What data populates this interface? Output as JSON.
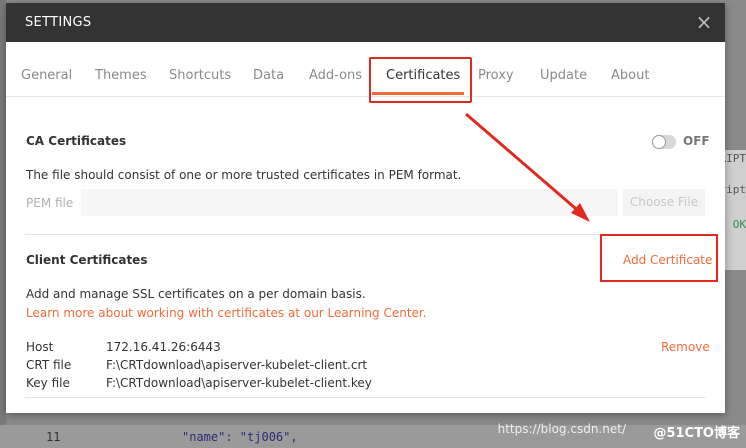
{
  "background": {
    "right_snippets": [
      "RIPT",
      "ript",
      "OK"
    ],
    "line_number": "11",
    "code_line": "\"name\": \"tj006\",",
    "watermark": "https://blog.csdn.net/",
    "logo": "@51CTO博客"
  },
  "modal": {
    "title": "SETTINGS",
    "close_icon": "×"
  },
  "tabs": [
    "General",
    "Themes",
    "Shortcuts",
    "Data",
    "Add-ons",
    "Certificates",
    "Proxy",
    "Update",
    "About"
  ],
  "active_tab": "Certificates",
  "ca": {
    "title": "CA Certificates",
    "toggle_label": "OFF",
    "description": "The file should consist of one or more trusted certificates in PEM format.",
    "pem_label": "PEM file",
    "choose_file": "Choose File"
  },
  "client": {
    "title": "Client Certificates",
    "add_button": "Add Certificate",
    "description": "Add and manage SSL certificates on a per domain basis.",
    "learn_more": "Learn more about working with certificates at our Learning Center.",
    "cert": {
      "host_label": "Host",
      "host_value": "172.16.41.26:6443",
      "crt_label": "CRT file",
      "crt_value": "F:\\CRTdownload\\apiserver-kubelet-client.crt",
      "key_label": "Key file",
      "key_value": "F:\\CRTdownload\\apiserver-kubelet-client.key",
      "remove": "Remove"
    }
  },
  "colors": {
    "accent": "#f26b3a",
    "header_bg": "#333333",
    "annotation_red": "#e0291f"
  }
}
